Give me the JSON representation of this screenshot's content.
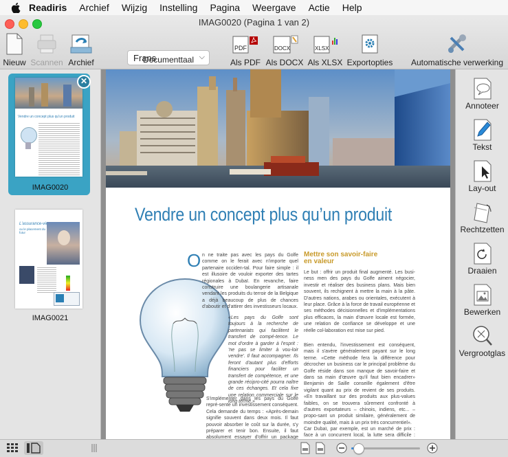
{
  "menubar": {
    "app": "Readiris",
    "items": [
      "Archief",
      "Wijzig",
      "Instelling",
      "Pagina",
      "Weergave",
      "Actie",
      "Help"
    ]
  },
  "window": {
    "title": "IMAG0020 (Pagina 1 van 2)"
  },
  "toolbar": {
    "new_label": "Nieuw",
    "scan_label": "Scannen",
    "archive_label": "Archief",
    "language_value": "Frans",
    "language_label": "Documenttaal",
    "pdf_label": "Als PDF",
    "docx_label": "Als DOCX",
    "xlsx_label": "Als XLSX",
    "export_label": "Exportopties",
    "auto_label": "Automatische verwerking",
    "pdf_badge": "PDF",
    "docx_badge": "DOCX",
    "xlsx_badge": "XLSX"
  },
  "thumbnails": [
    {
      "name": "IMAG0020",
      "selected": true,
      "mini_title": "Vendre un concept plus qu'un produit"
    },
    {
      "name": "IMAG0021",
      "selected": false,
      "mini_title": "L'assurance-vie",
      "mini_sub": "ou le placement du futur"
    }
  ],
  "rightpanel": {
    "items": [
      "Annoteer",
      "Tekst",
      "Lay-out",
      "Rechtzetten",
      "Draaien",
      "Bewerken",
      "Vergrootglas"
    ]
  },
  "document": {
    "headline": "Vendre un concept plus qu’un produit",
    "dropcap": "O",
    "col1_para1": "n ne traite pas avec les pays du Golfe comme on le ferait avec n'importe quel partenaire occiden-tal. Pour faire simple : il est illusoire de vouloir exporter des tartes régionales à Dubaï. En revanche, faire construire une boulangerie artisanale vendant les produits du terroir de la Belgique a déjà beaucoup de plus de chances d'aboutir et d'attirer des investisseurs locaux.",
    "col1_para2": "«Les pays du Golfe sont toujours à la recherche de partenariats qui facilitent le transfert de compé-tence. Le mot d'ordre à garder à l'esprit : 'ne pas se limiter à vou-loir vendre'. Il faut accompagner. Ils feront d'autant plus d'efforts financiers pour faciliter un transfert de compétence, et une grande récipro-cité pourra naître de ces échanges. Et cela fixe une relation commerciale sur le long terme.»",
    "col1_para3": "S'implémenter dans les pays du Golfe repré-sente un investissement conséquent. Cela demande du temps : «Après-demain signifie souvent dans deux mois. Il faut pouvoir absorber le coût sur la durée, s'y préparer et tenir bon. Ensuite, il faut absolument essayer d'offrir un package complet au client. Si on vend, par",
    "subhead": "Mettre son savoir-faire en valeur",
    "col2_para1": "Le but : offrir un produit final augmenté. Les busi-ness men des pays du Golfe aiment négocier, investir et réaliser des business plans. Mais bien souvent, ils rechignent à mettre la main à la pâte. D'autres nations, arabes ou orientales, exécutent à leur place. Grâce à la force de travail européenne et ses méthodes décisionnelles et d'implémentations plus efficaces, la main d'œuvre locale est formée, une relation de confiance se développe et une réelle col-laboration est mise sur pied.",
    "col2_para2": "Bien entendu, l'investissement est conséquent, mais il s'avère généralement payant sur le long terme. «Cette méthode fera la différence pour décrocher un business car le principal problème du Golfe réside dans son manque de savoir-faire et dans sa main d'œuvre qu'il faut bien encadrer» Benjamin de Saille conseille également d'être vigilant quant au prix de revient de ses produits. «En travaillant sur des produits aux plus-values faibles, on se trouvera sûrement confronté à d'autres exportateurs – chinois, indiens, etc... – propo-sant un produit similaire, généralement de moindre qualité, mais à un prix très concurrentiel».",
    "col2_para3": "Car Dubaï, par exemple, est un marché de prix : face à un concurrent local, la lutte sera difficile : euro"
  },
  "colors": {
    "selection": "#3aa3c4",
    "headline": "#2f7fb4",
    "subhead": "#c89a2a",
    "close_red": "#fe5f57",
    "minimize_yellow": "#febc2e",
    "zoom_green": "#28c840"
  },
  "zoom": {
    "level": 0.1
  }
}
